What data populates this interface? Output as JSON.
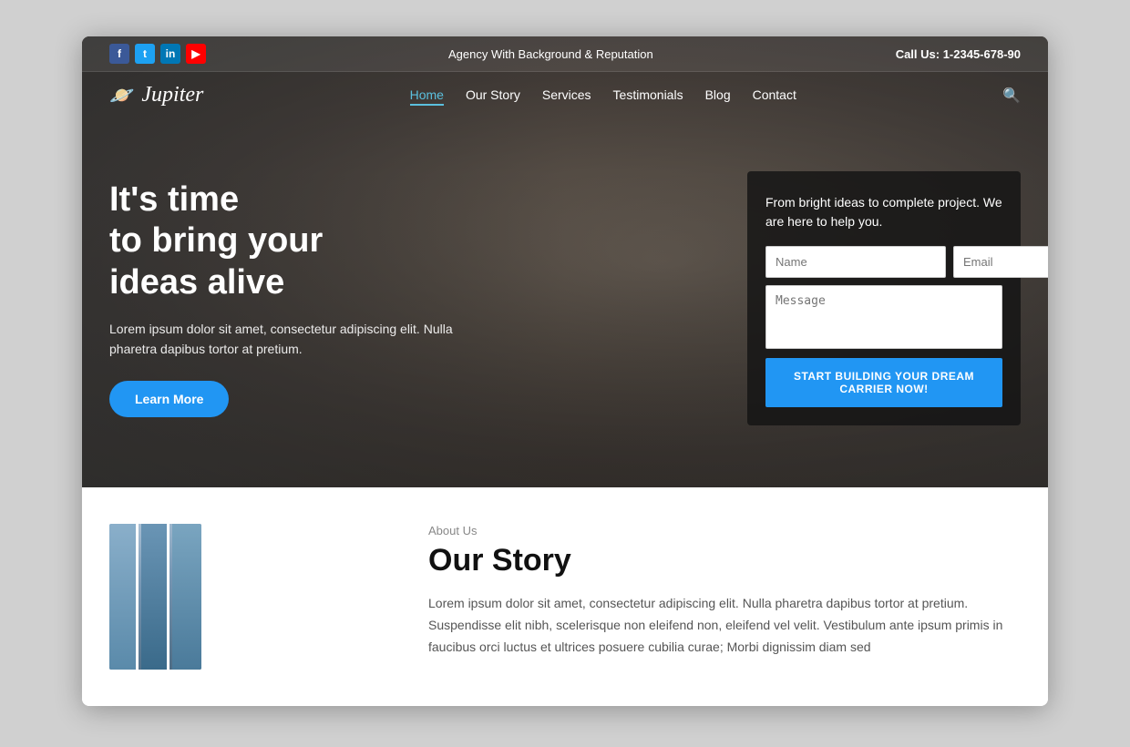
{
  "topbar": {
    "tagline": "Agency With Background & Reputation",
    "phone": "Call Us: 1-2345-678-90"
  },
  "social": {
    "facebook": "f",
    "twitter": "t",
    "linkedin": "in",
    "youtube": "▶"
  },
  "logo": {
    "icon": "🪐",
    "text": "Jupiter"
  },
  "nav": {
    "items": [
      {
        "label": "Home",
        "active": true
      },
      {
        "label": "Our Story",
        "active": false
      },
      {
        "label": "Services",
        "active": false
      },
      {
        "label": "Testimonials",
        "active": false
      },
      {
        "label": "Blog",
        "active": false
      },
      {
        "label": "Contact",
        "active": false
      }
    ]
  },
  "hero": {
    "heading": "It's time\nto bring your\nideas alive",
    "subtext": "Lorem ipsum dolor sit amet, consectetur adipiscing elit. Nulla pharetra dapibus tortor at pretium.",
    "cta_label": "Learn More"
  },
  "contact_form": {
    "intro": "From bright ideas to complete project. We are here to help you.",
    "name_placeholder": "Name",
    "email_placeholder": "Email",
    "message_placeholder": "Message",
    "submit_label": "START BUILDING YOUR DREAM CARRIER NOW!"
  },
  "about": {
    "label": "About Us",
    "title": "Our Story",
    "body": "Lorem ipsum dolor sit amet, consectetur adipiscing elit. Nulla pharetra dapibus tortor at pretium. Suspendisse elit nibh, scelerisque non eleifend non, eleifend vel velit. Vestibulum ante ipsum primis in faucibus orci luctus et ultrices posuere cubilia curae; Morbi dignissim diam sed"
  }
}
